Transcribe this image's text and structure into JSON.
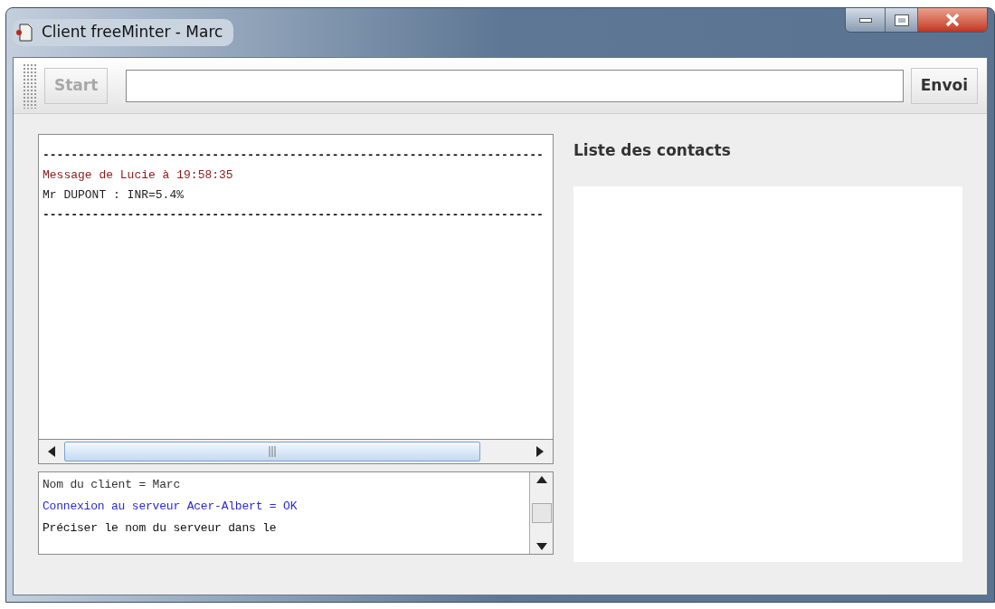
{
  "window": {
    "title": "Client freeMinter - Marc"
  },
  "toolbar": {
    "start_button": {
      "label": "Start",
      "disabled": true
    },
    "send_button": {
      "label": "Envoi",
      "disabled": false
    }
  },
  "messages": [
    {
      "kind": "separator",
      "text": "-----------------------------------------------------------------------",
      "color": "#000000"
    },
    {
      "kind": "line",
      "text": "Message de Lucie à 19:58:35",
      "color": "#8b1a1a"
    },
    {
      "kind": "line",
      "text": "Mr DUPONT : INR=5.4%",
      "color": "#222222"
    },
    {
      "kind": "separator",
      "text": "-----------------------------------------------------------------------",
      "color": "#000000"
    }
  ],
  "log": [
    {
      "text": "Nom du client = Marc",
      "color": "#333333"
    },
    {
      "text": "Connexion au serveur Acer-Albert = OK",
      "color": "#2b2bd0"
    },
    {
      "text": "Préciser le nom du serveur dans le",
      "color": "#111111"
    }
  ],
  "contacts": {
    "title": "Liste des contacts"
  }
}
